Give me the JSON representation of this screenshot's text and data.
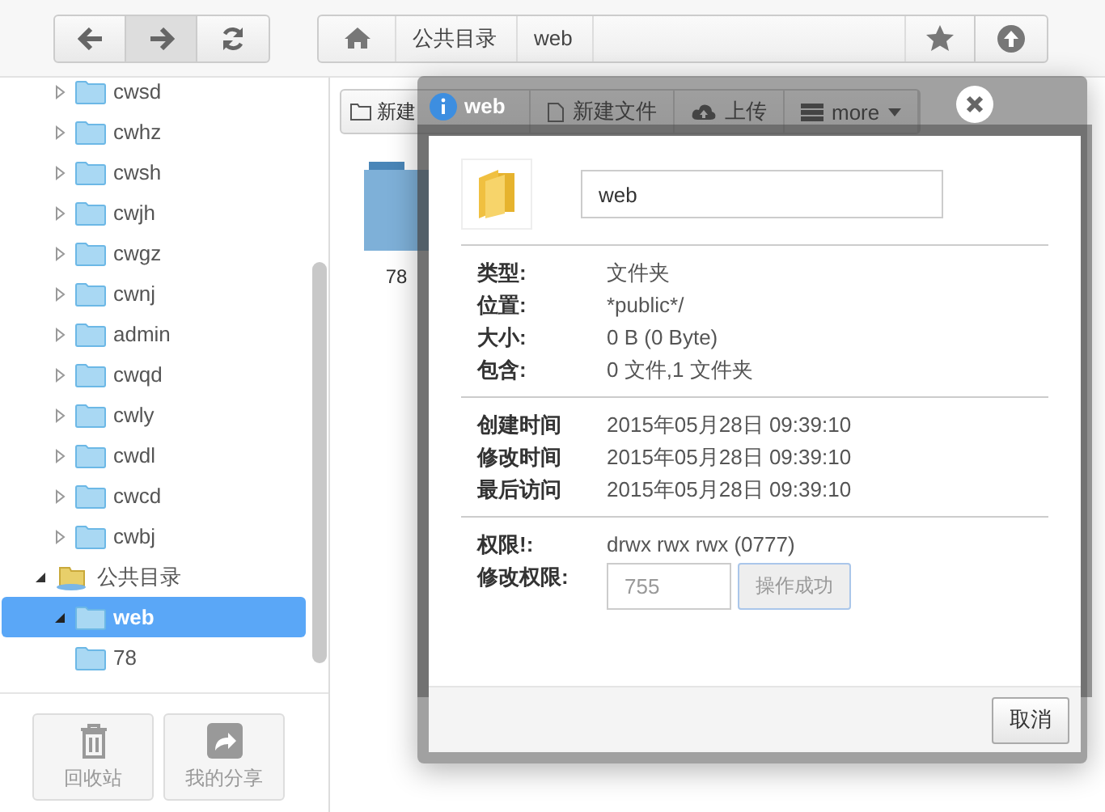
{
  "topbar": {
    "breadcrumb": [
      "公共目录",
      "web"
    ]
  },
  "sidebar": {
    "tree": [
      {
        "kind": "hidden-root",
        "children": [
          {
            "kind": "folder",
            "label": "cwsd",
            "expanded": false,
            "selected": false
          },
          {
            "kind": "folder",
            "label": "cwhz",
            "expanded": false,
            "selected": false
          },
          {
            "kind": "folder",
            "label": "cwsh",
            "expanded": false,
            "selected": false
          },
          {
            "kind": "folder",
            "label": "cwjh",
            "expanded": false,
            "selected": false
          },
          {
            "kind": "folder",
            "label": "cwgz",
            "expanded": false,
            "selected": false
          },
          {
            "kind": "folder",
            "label": "cwnj",
            "expanded": false,
            "selected": false
          },
          {
            "kind": "folder",
            "label": "admin",
            "expanded": false,
            "selected": false
          },
          {
            "kind": "folder",
            "label": "cwqd",
            "expanded": false,
            "selected": false
          },
          {
            "kind": "folder",
            "label": "cwly",
            "expanded": false,
            "selected": false
          },
          {
            "kind": "folder",
            "label": "cwdl",
            "expanded": false,
            "selected": false
          },
          {
            "kind": "folder",
            "label": "cwcd",
            "expanded": false,
            "selected": false
          },
          {
            "kind": "folder",
            "label": "cwbj",
            "expanded": false,
            "selected": false
          }
        ]
      },
      {
        "kind": "public-root",
        "label": "公共目录",
        "expanded": true,
        "selected": false,
        "children": [
          {
            "kind": "folder",
            "label": "web",
            "expanded": true,
            "selected": true,
            "children": [
              {
                "kind": "leaf",
                "label": "78",
                "selected": false
              }
            ]
          }
        ]
      }
    ],
    "bottom_buttons": [
      {
        "kind": "trash",
        "label": "回收站"
      },
      {
        "kind": "share",
        "label": "我的分享"
      }
    ]
  },
  "content": {
    "toolbar": [
      {
        "kind": "folder",
        "label": "新建"
      },
      {
        "kind": "file",
        "label": "新建文件"
      },
      {
        "kind": "upload",
        "label": "上传"
      },
      {
        "kind": "more",
        "label": "more"
      }
    ],
    "files": [
      {
        "name": "78"
      }
    ]
  },
  "dialog": {
    "title": "web",
    "name": "web",
    "groups": [
      [
        {
          "label": "类型:",
          "value": "文件夹"
        },
        {
          "label": "位置:",
          "value": "*public*/"
        },
        {
          "label": "大小:",
          "value": "0 B (0 Byte)"
        },
        {
          "label": "包含:",
          "value": "0 文件,1 文件夹"
        }
      ],
      [
        {
          "label": "创建时间",
          "value": "2015年05月28日 09:39:10"
        },
        {
          "label": "修改时间",
          "value": "2015年05月28日 09:39:10"
        },
        {
          "label": "最后访问",
          "value": "2015年05月28日 09:39:10"
        }
      ]
    ],
    "permission": {
      "label": "权限!:",
      "value": "drwx rwx rwx (0777)"
    },
    "chmod": {
      "label": "修改权限:",
      "placeholder": "755",
      "button": "操作成功",
      "disabled": true
    },
    "cancel": "取消"
  }
}
